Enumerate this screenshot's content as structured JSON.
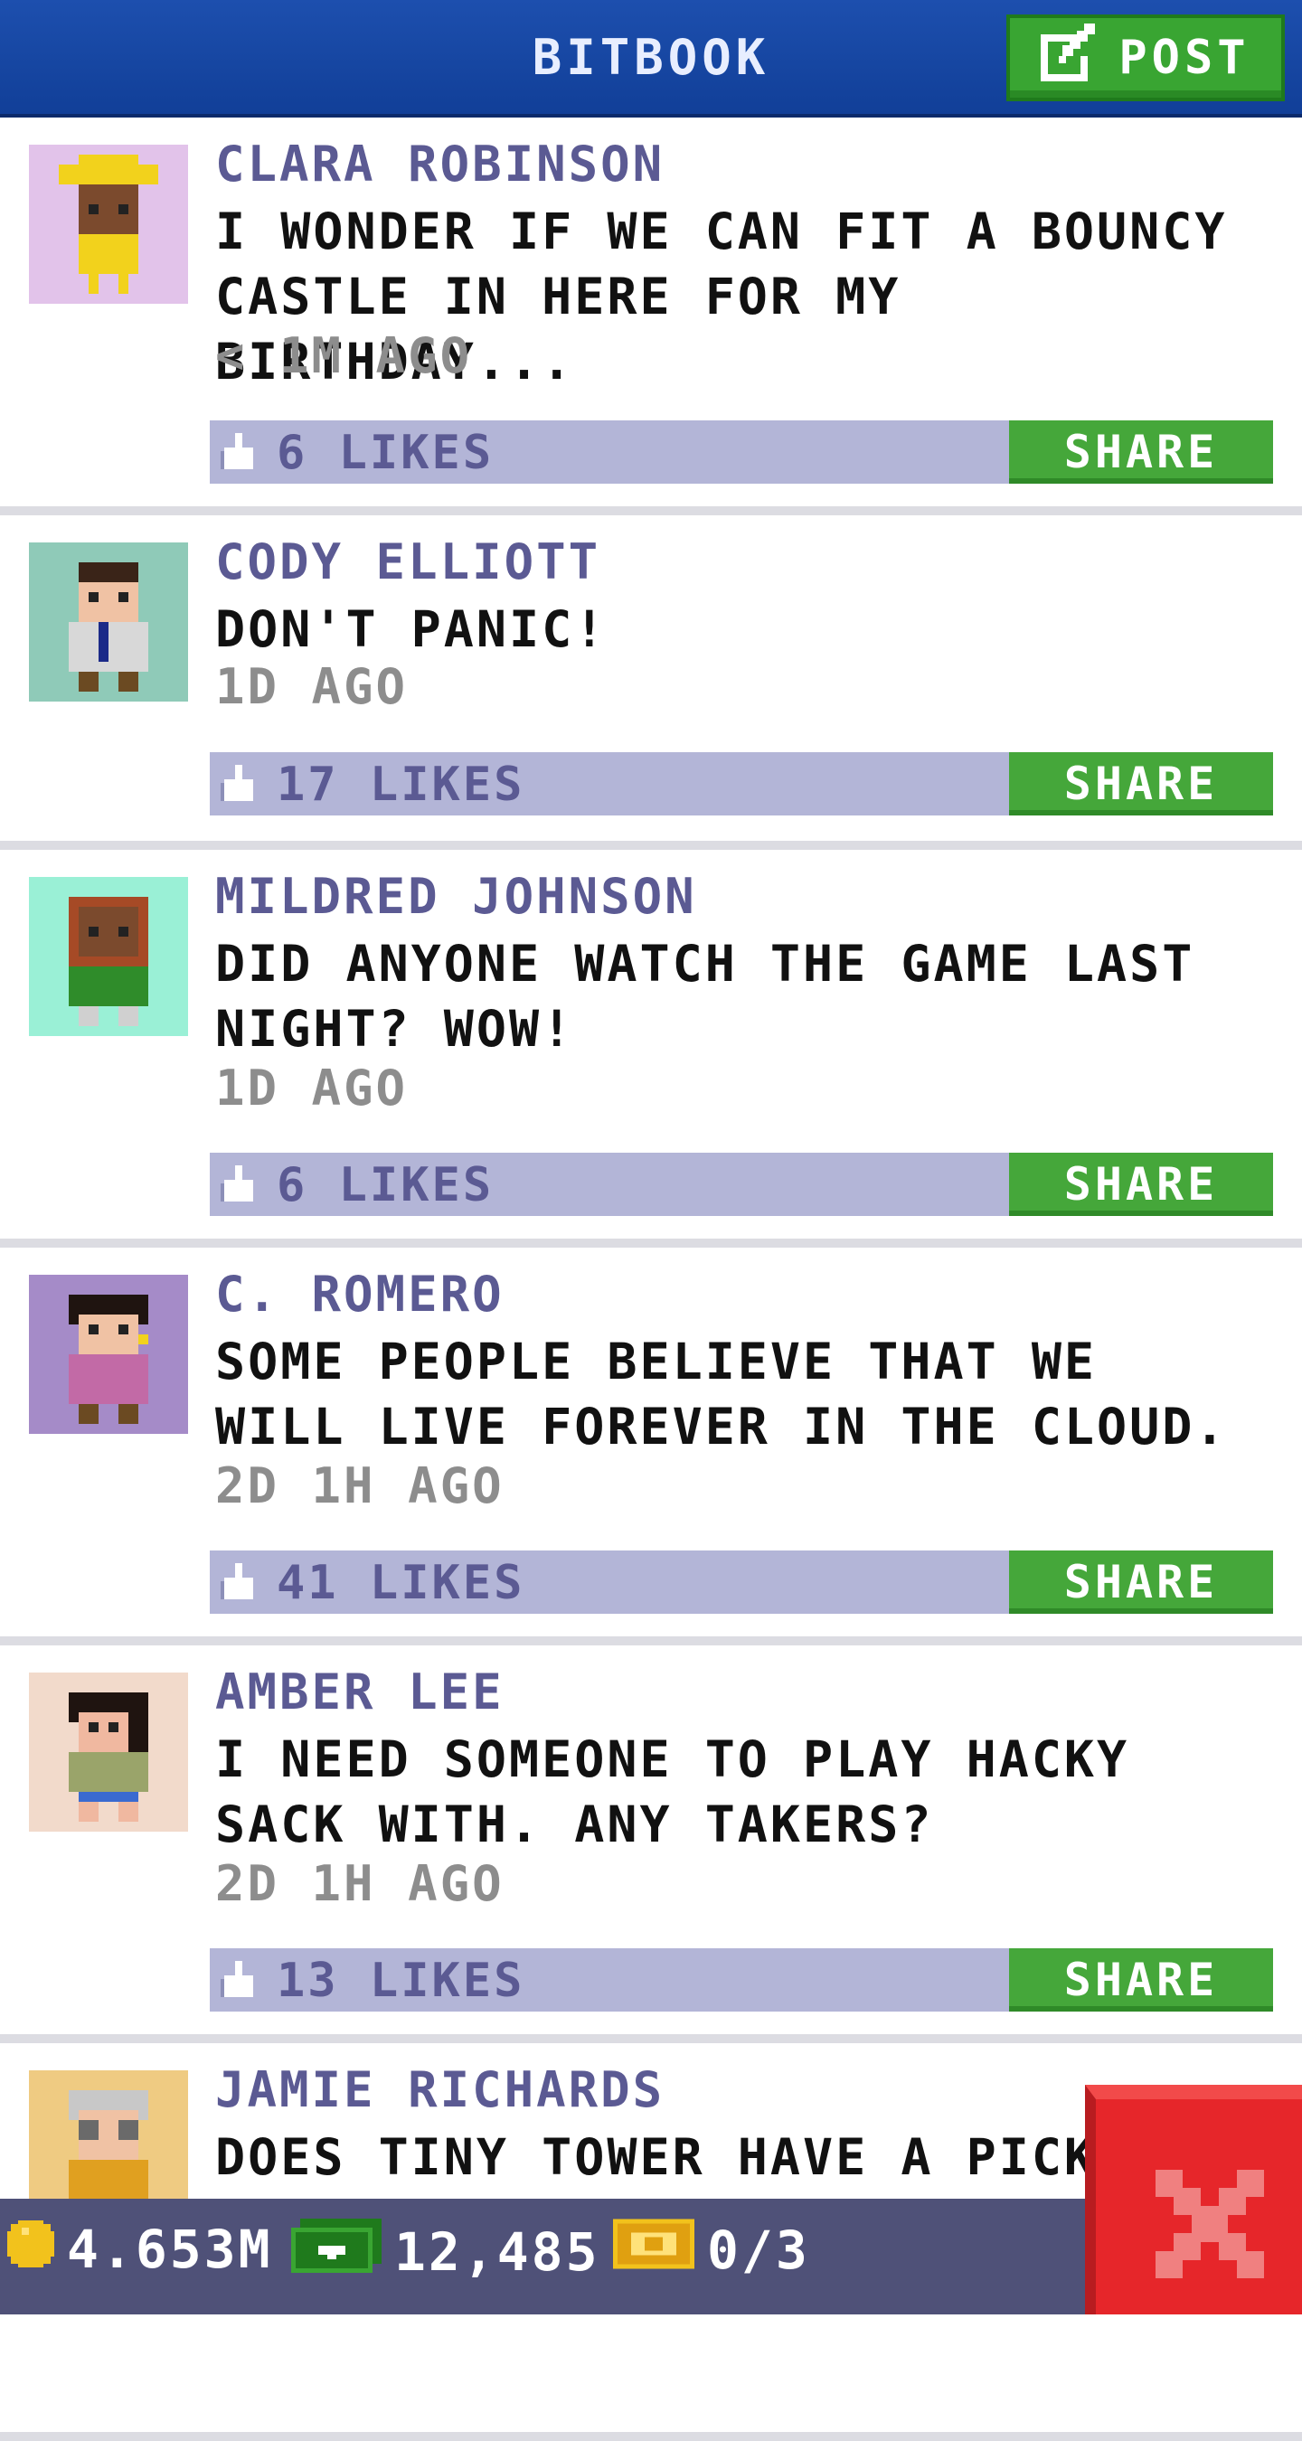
{
  "header": {
    "title": "BITBOOK",
    "post_label": "POST"
  },
  "posts": [
    {
      "name": "CLARA ROBINSON",
      "message": "I WONDER IF WE CAN FIT A BOUNCY CASTLE IN HERE FOR MY BIRTHDAY...",
      "time": "< 1M AGO",
      "likes": "6 LIKES",
      "share": "SHARE",
      "avatar_bg": "#e2c3ea"
    },
    {
      "name": "CODY ELLIOTT",
      "message": "DON'T PANIC!",
      "time": "1D AGO",
      "likes": "17 LIKES",
      "share": "SHARE",
      "avatar_bg": "#8fcab8"
    },
    {
      "name": "MILDRED JOHNSON",
      "message": "DID ANYONE WATCH THE GAME LAST NIGHT? WOW!",
      "time": "1D AGO",
      "likes": "6 LIKES",
      "share": "SHARE",
      "avatar_bg": "#9af0d6"
    },
    {
      "name": "C. ROMERO",
      "message": "SOME PEOPLE BELIEVE THAT WE WILL LIVE FOREVER IN THE CLOUD.",
      "time": "2D 1H AGO",
      "likes": "41 LIKES",
      "share": "SHARE",
      "avatar_bg": "#a58bc8"
    },
    {
      "name": "AMBER LEE",
      "message": "I NEED SOMEONE TO PLAY HACKY SACK WITH. ANY TAKERS?",
      "time": "2D 1H AGO",
      "likes": "13 LIKES",
      "share": "SHARE",
      "avatar_bg": "#f2dacb"
    },
    {
      "name": "JAMIE RICHARDS",
      "message": "DOES TINY TOWER HAVE A PICKL",
      "avatar_bg": "#efcb82"
    }
  ],
  "status": {
    "coins": "4.653M",
    "bux": "12,485",
    "tickets": "0/3"
  },
  "icons": {
    "post": "edit-icon",
    "like": "thumbs-up-icon",
    "close": "close-icon",
    "coin": "coin-icon",
    "bux": "bux-icon",
    "ticket": "ticket-icon"
  },
  "colors": {
    "header": "#1a4ca8",
    "accent_green": "#45a73a",
    "like_bar": "#b3b5d7",
    "name_text": "#5b5a93",
    "close_red": "#e6262a"
  }
}
